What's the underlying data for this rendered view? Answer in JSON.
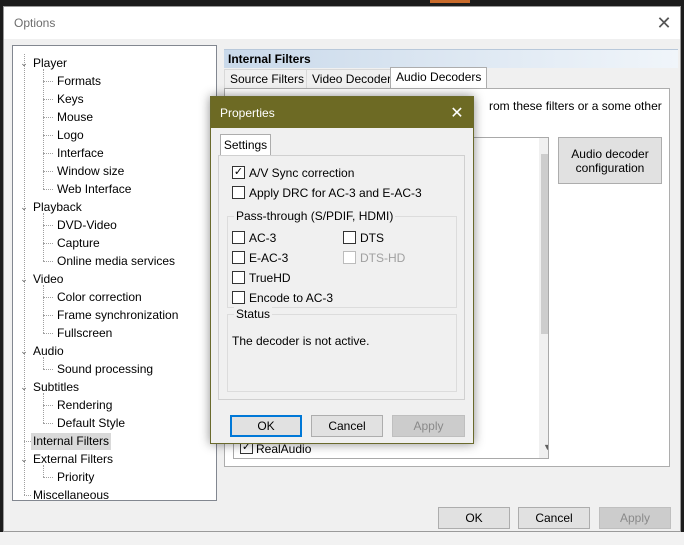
{
  "window": {
    "title": "Options",
    "close_glyph": "✕"
  },
  "tree": {
    "items": [
      {
        "label": "Player",
        "level": 0,
        "expanded": true
      },
      {
        "label": "Formats",
        "level": 1
      },
      {
        "label": "Keys",
        "level": 1
      },
      {
        "label": "Mouse",
        "level": 1
      },
      {
        "label": "Logo",
        "level": 1
      },
      {
        "label": "Interface",
        "level": 1
      },
      {
        "label": "Window size",
        "level": 1
      },
      {
        "label": "Web Interface",
        "level": 1
      },
      {
        "label": "Playback",
        "level": 0,
        "expanded": true
      },
      {
        "label": "DVD-Video",
        "level": 1
      },
      {
        "label": "Capture",
        "level": 1
      },
      {
        "label": "Online media services",
        "level": 1
      },
      {
        "label": "Video",
        "level": 0,
        "expanded": true
      },
      {
        "label": "Color correction",
        "level": 1
      },
      {
        "label": "Frame synchronization",
        "level": 1
      },
      {
        "label": "Fullscreen",
        "level": 1
      },
      {
        "label": "Audio",
        "level": 0,
        "expanded": true
      },
      {
        "label": "Sound processing",
        "level": 1
      },
      {
        "label": "Subtitles",
        "level": 0,
        "expanded": true
      },
      {
        "label": "Rendering",
        "level": 1
      },
      {
        "label": "Default Style",
        "level": 1
      },
      {
        "label": "Internal Filters",
        "level": 0,
        "selected": true
      },
      {
        "label": "External Filters",
        "level": 0,
        "expanded": true
      },
      {
        "label": "Priority",
        "level": 1
      },
      {
        "label": "Miscellaneous",
        "level": 0
      }
    ],
    "toggle_glyph": "⌄"
  },
  "page": {
    "header": "Internal Filters",
    "tabs": [
      "Source Filters",
      "Video Decoders",
      "Audio Decoders"
    ],
    "active_tab": "Audio Decoders",
    "panel_text": "rom these filters or a some other",
    "audio_config_button": "Audio decoder configuration",
    "list_item_partial": "RealAudio",
    "check_glyph": "✓",
    "scroll_down_glyph": "▼"
  },
  "buttons": {
    "ok": "OK",
    "cancel": "Cancel",
    "apply": "Apply"
  },
  "properties": {
    "title": "Properties",
    "close_glyph": "✕",
    "tab": "Settings",
    "av_sync": {
      "label": "A/V Sync correction",
      "checked": true
    },
    "apply_drc": {
      "label": "Apply DRC for AC-3 and E-AC-3",
      "checked": false
    },
    "passthrough": {
      "title": "Pass-through (S/PDIF, HDMI)",
      "ac3": {
        "label": "AC-3",
        "checked": false
      },
      "dts": {
        "label": "DTS",
        "checked": false
      },
      "eac3": {
        "label": "E-AC-3",
        "checked": false
      },
      "dtshd": {
        "label": "DTS-HD",
        "checked": false,
        "disabled": true
      },
      "truehd": {
        "label": "TrueHD",
        "checked": false
      },
      "encode_ac3": {
        "label": "Encode to AC-3",
        "checked": false
      }
    },
    "status": {
      "title": "Status",
      "text": "The decoder is not active."
    },
    "ok": "OK",
    "cancel": "Cancel",
    "apply": "Apply"
  },
  "colors": {
    "dialog_titlebar": "#6d6a24",
    "selection": "#d9d9d9",
    "default_button_border": "#0078d7"
  }
}
